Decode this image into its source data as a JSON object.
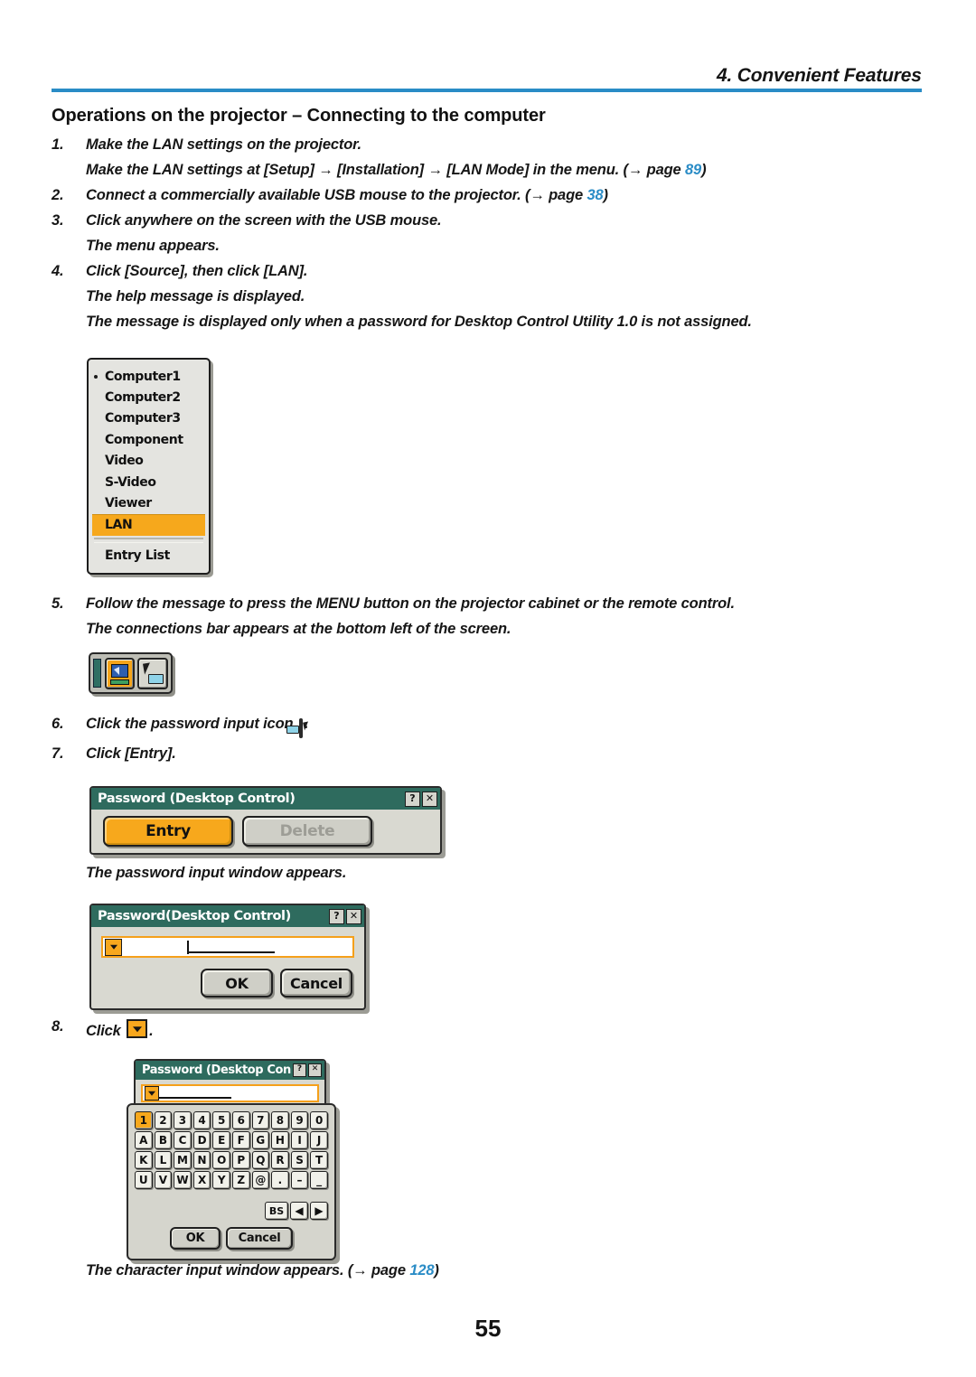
{
  "header": {
    "chapter_title": "4. Convenient Features"
  },
  "section": {
    "title": "Operations on the projector – Connecting to the computer"
  },
  "steps": [
    {
      "num": "1.",
      "text": "Make the LAN settings on the projector."
    },
    {
      "num": "",
      "text": "Make the LAN settings at [Setup] → [Installation] → [LAN Mode] in the menu.  (→ page ",
      "page_ref": "89",
      "suffix": ")"
    },
    {
      "num": "2.",
      "text": "Connect a commercially available USB mouse to the projector. (→ page ",
      "page_ref": "38",
      "suffix": ")"
    },
    {
      "num": "3.",
      "text": "Click anywhere on the screen with the USB mouse."
    },
    {
      "num": "",
      "text": "The menu appears."
    },
    {
      "num": "4.",
      "text": "Click [Source], then click [LAN]."
    },
    {
      "num": "",
      "text": "The help message is displayed."
    },
    {
      "num": "",
      "text": "The message is displayed only when a password for Desktop Control Utility 1.0 is not assigned."
    },
    {
      "num": "5.",
      "text": "Follow the message to press the MENU button on the projector cabinet or the remote control."
    },
    {
      "num": "",
      "text": "The connections bar appears at the bottom left of the screen."
    },
    {
      "num": "6.",
      "text": "Click the password input icon",
      "suffix": "."
    },
    {
      "num": "7.",
      "text": "Click [Entry]."
    },
    {
      "num": "",
      "text": "The password input window appears."
    },
    {
      "num": "8.",
      "text": "Click",
      "suffix": "."
    },
    {
      "num": "",
      "text": "The character input window appears. (→ page ",
      "page_ref": "128",
      "suffix": ")"
    }
  ],
  "source_menu": {
    "items": [
      {
        "label": "Computer1",
        "bullet": true,
        "selected": false
      },
      {
        "label": "Computer2",
        "bullet": false,
        "selected": false
      },
      {
        "label": "Computer3",
        "bullet": false,
        "selected": false
      },
      {
        "label": "Component",
        "bullet": false,
        "selected": false
      },
      {
        "label": "Video",
        "bullet": false,
        "selected": false
      },
      {
        "label": "S-Video",
        "bullet": false,
        "selected": false
      },
      {
        "label": "Viewer",
        "bullet": false,
        "selected": false
      },
      {
        "label": "LAN",
        "bullet": false,
        "selected": true
      },
      {
        "label": "Entry List",
        "bullet": false,
        "selected": false
      }
    ],
    "highlight_color": "#f6a81c"
  },
  "connections_bar": {
    "buttons": [
      {
        "icon": "projector-display-icon",
        "active": true
      },
      {
        "icon": "password-input-cursor-icon",
        "active": false
      }
    ]
  },
  "dialog_entry": {
    "title": "Password (Desktop Control)",
    "help_btn": "?",
    "close_btn": "✕",
    "entry_label": "Entry",
    "delete_label": "Delete"
  },
  "dialog_password": {
    "title": "Password(Desktop Control)",
    "help_btn": "?",
    "close_btn": "✕",
    "input_value": "",
    "ok_label": "OK",
    "cancel_label": "Cancel"
  },
  "dialog_char_input": {
    "title": "Password (Desktop Contr",
    "help_btn": "?",
    "close_btn": "✕",
    "input_value": "",
    "keyboard_rows": [
      [
        "1",
        "2",
        "3",
        "4",
        "5",
        "6",
        "7",
        "8",
        "9",
        "0"
      ],
      [
        "A",
        "B",
        "C",
        "D",
        "E",
        "F",
        "G",
        "H",
        "I",
        "J"
      ],
      [
        "K",
        "L",
        "M",
        "N",
        "O",
        "P",
        "Q",
        "R",
        "S",
        "T"
      ],
      [
        "U",
        "V",
        "W",
        "X",
        "Y",
        "Z",
        "@",
        ".",
        "–",
        "_"
      ]
    ],
    "selected_key": "1",
    "control_keys": [
      "BS",
      "◀",
      "▶"
    ],
    "ok_label": "OK",
    "cancel_label": "Cancel"
  },
  "footer": {
    "page_number": "55"
  },
  "colors": {
    "rule_blue": "#2a8cc6",
    "link_blue": "#2a8cc6",
    "osd_orange": "#f6a81c",
    "titlebar_green": "#2e6b5e"
  }
}
